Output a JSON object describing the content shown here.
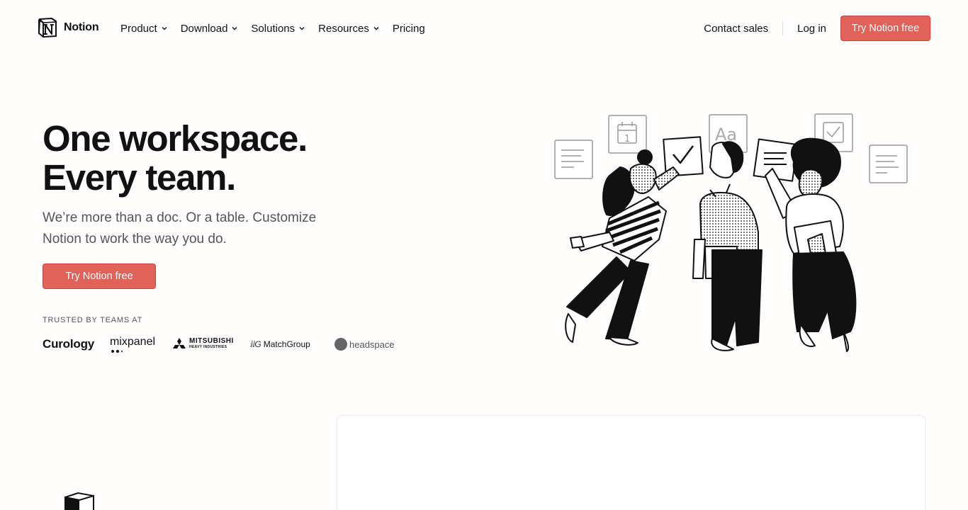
{
  "brand": {
    "name": "Notion"
  },
  "nav": {
    "menu": [
      {
        "label": "Product",
        "dropdown": true
      },
      {
        "label": "Download",
        "dropdown": true
      },
      {
        "label": "Solutions",
        "dropdown": true
      },
      {
        "label": "Resources",
        "dropdown": true
      },
      {
        "label": "Pricing",
        "dropdown": false
      }
    ],
    "contact_sales": "Contact sales",
    "login": "Log in",
    "cta": "Try Notion free"
  },
  "hero": {
    "title_line1": "One workspace.",
    "title_line2": "Every team.",
    "subtitle": "We’re more than a doc. Or a table. Customize Notion to work the way you do.",
    "cta": "Try Notion free",
    "trusted_label": "TRUSTED BY TEAMS AT",
    "logos": {
      "curology": "Curology",
      "mixpanel": "mixpanel",
      "mitsubishi": "MITSUBISHI",
      "mitsubishi_sub": "HEAVY INDUSTRIES",
      "matchgroup_mark": "ⅈⅈG",
      "matchgroup": "MatchGroup",
      "headspace": "headspace"
    }
  },
  "colors": {
    "accent": "#e16259",
    "background": "#fffefc",
    "text": "#111111",
    "muted": "#555555"
  },
  "icons": [
    "notion-logo-icon",
    "chevron-down-icon",
    "notion-cube-icon"
  ]
}
